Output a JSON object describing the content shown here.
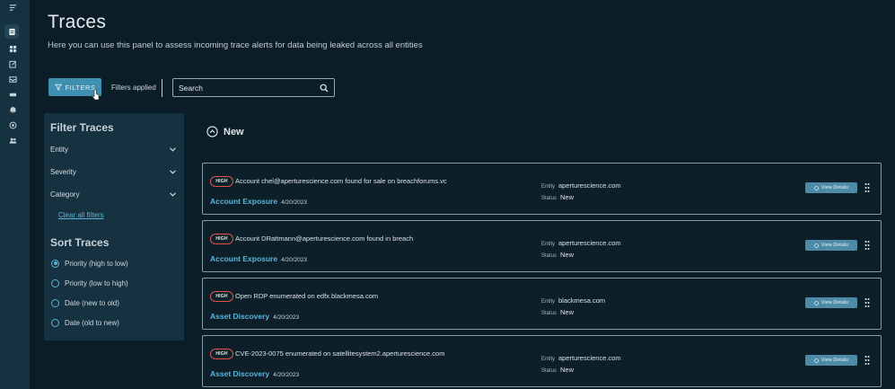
{
  "page": {
    "title": "Traces",
    "subtitle": "Here you can use this panel to assess incoming trace alerts for data being leaked across all entities"
  },
  "toolbar": {
    "filters_label": "FILTERS",
    "filters_applied": "Filters applied",
    "search_placeholder": "Search"
  },
  "rail": {
    "icons": [
      "menu-icon",
      "traces-icon",
      "dashboard-icon",
      "reports-icon",
      "inbox-icon",
      "cards-icon",
      "alerts-icon",
      "integrations-icon",
      "users-icon"
    ]
  },
  "filter_panel": {
    "title": "Filter Traces",
    "facets": [
      "Entity",
      "Severity",
      "Category"
    ],
    "clear_label": "Clear all filters",
    "sort_title": "Sort Traces",
    "sort_options": [
      "Priority (high to low)",
      "Priority (low to high)",
      "Date (new to old)",
      "Date (old to new)"
    ],
    "sort_selected": 0
  },
  "section": {
    "label": "New"
  },
  "traces": [
    {
      "severity": "HIGH",
      "title": "Account chel@aperturescience.com found for sale on breachforums.vc",
      "type": "Account Exposure",
      "date": "4/20/2023",
      "entity_key": "Entity",
      "entity": "aperturescience.com",
      "status_key": "Status",
      "status": "New",
      "action": "View Details"
    },
    {
      "severity": "HIGH",
      "title": "Account DRattmann@aperturescience.com found in breach",
      "type": "Account Exposure",
      "date": "4/20/2023",
      "entity_key": "Entity",
      "entity": "aperturescience.com",
      "status_key": "Status",
      "status": "New",
      "action": "View Details"
    },
    {
      "severity": "HIGH",
      "title": "Open RDP enumerated on edfx.blackmesa.com",
      "type": "Asset Discovery",
      "date": "4/20/2023",
      "entity_key": "Entity",
      "entity": "blackmesa.com",
      "status_key": "Status",
      "status": "New",
      "action": "View Details"
    },
    {
      "severity": "HIGH",
      "title": "CVE-2023-0075 enumerated on satellitesystem2.aperturescience.com",
      "type": "Asset Discovery",
      "date": "4/20/2023",
      "entity_key": "Entity",
      "entity": "aperturescience.com",
      "status_key": "Status",
      "status": "New",
      "action": "View Details"
    }
  ],
  "colors": {
    "background": "#0b1d26",
    "panel": "#163240",
    "accent": "#5ab4d9",
    "primary_button": "#3f8fb0",
    "high_badge": "#e05353"
  }
}
